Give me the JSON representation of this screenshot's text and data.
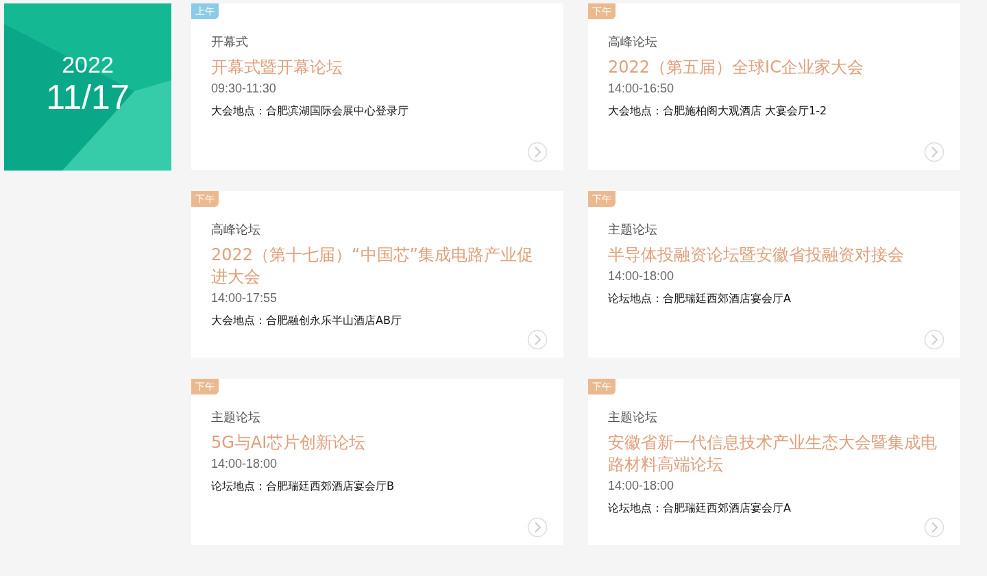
{
  "date_tile": {
    "year": "2022",
    "date": "11/17"
  },
  "sessions": [
    {
      "badge": {
        "text": "上午",
        "kind": "morning"
      },
      "category": "开幕式",
      "title": "开幕式暨开幕论坛",
      "time": "09:30-11:30",
      "location": "大会地点：合肥滨湖国际会展中心登录厅"
    },
    {
      "badge": {
        "text": "下午",
        "kind": "afternoon"
      },
      "category": "高峰论坛",
      "title": "2022（第五届）全球IC企业家大会",
      "time": "14:00-16:50",
      "location": "大会地点：合肥施柏阁大观酒店 大宴会厅1-2"
    },
    {
      "badge": {
        "text": "下午",
        "kind": "afternoon"
      },
      "category": "高峰论坛",
      "title": "2022（第十七届）“中国芯”集成电路产业促进大会",
      "time": "14:00-17:55",
      "location": "大会地点：合肥融创永乐半山酒店AB厅"
    },
    {
      "badge": {
        "text": "下午",
        "kind": "afternoon"
      },
      "category": "主题论坛",
      "title": "半导体投融资论坛暨安徽省投融资对接会",
      "time": "14:00-18:00",
      "location": "论坛地点：合肥瑞廷西郊酒店宴会厅A"
    },
    {
      "badge": {
        "text": "下午",
        "kind": "afternoon"
      },
      "category": "主题论坛",
      "title": "5G与AI芯片创新论坛",
      "time": "14:00-18:00",
      "location": "论坛地点：合肥瑞廷西郊酒店宴会厅B"
    },
    {
      "badge": {
        "text": "下午",
        "kind": "afternoon"
      },
      "category": "主题论坛",
      "title": "安徽省新一代信息技术产业生态大会暨集成电路材料高端论坛",
      "time": "14:00-18:00",
      "location": "论坛地点：合肥瑞廷西郊酒店宴会厅A"
    }
  ]
}
